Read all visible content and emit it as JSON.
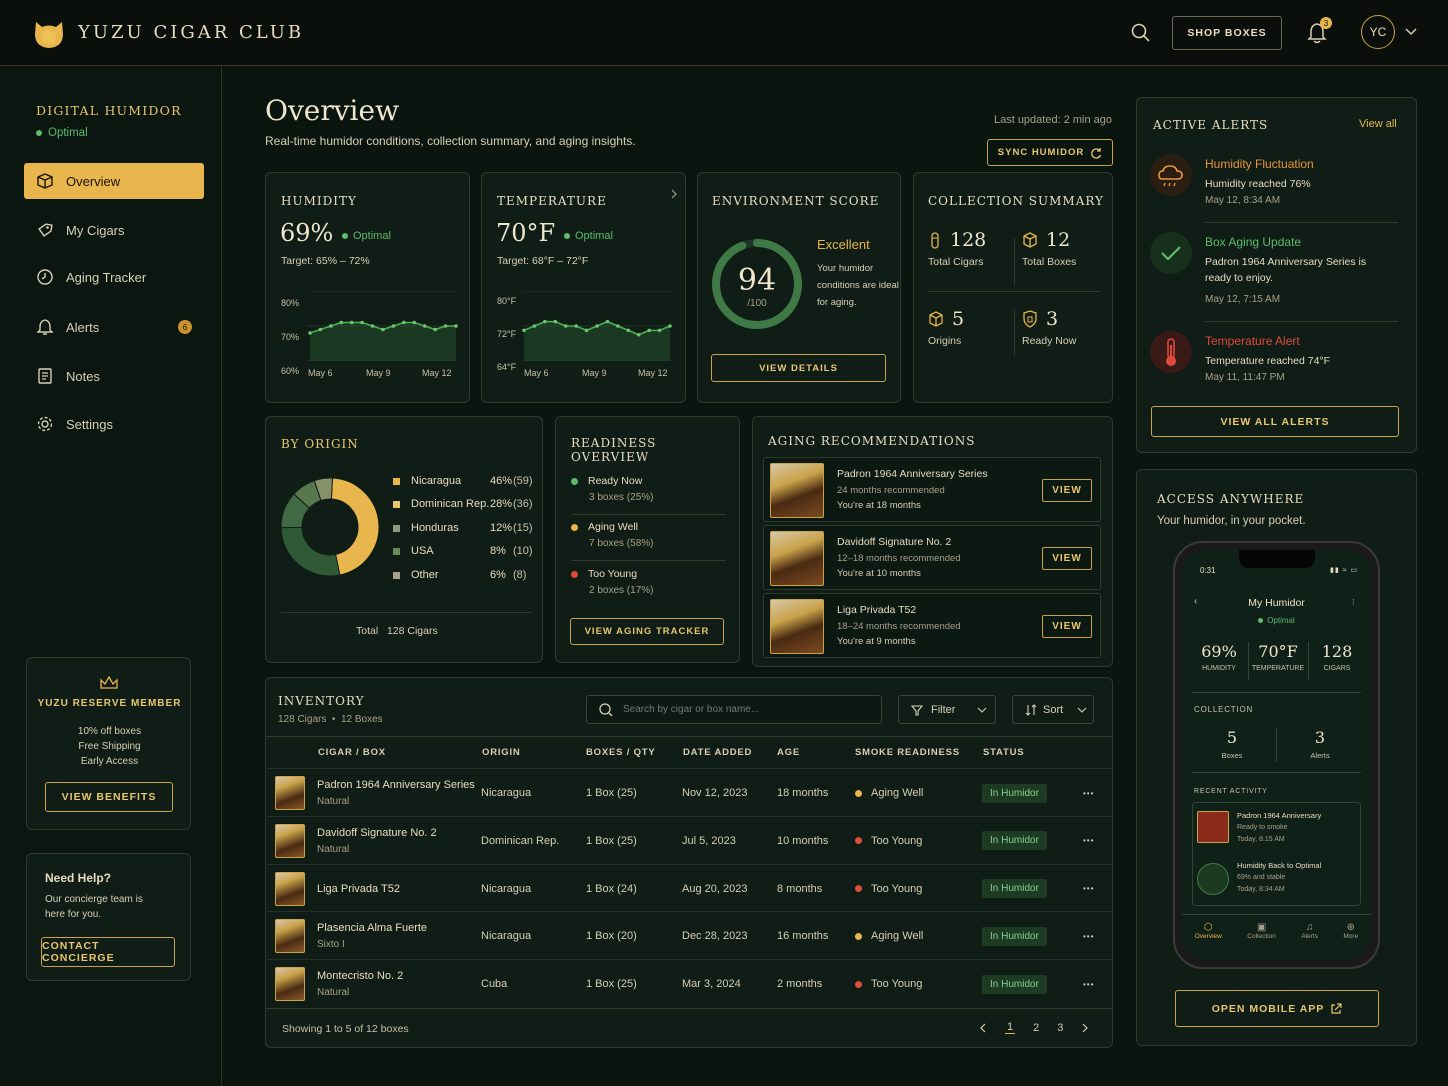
{
  "brand": {
    "name": "YUZU CIGAR CLUB"
  },
  "header": {
    "shop_label": "SHOP BOXES",
    "notif_count": "3",
    "avatar": "YC"
  },
  "sidebar": {
    "section_title": "DIGITAL HUMIDOR",
    "status": "Optimal",
    "items": [
      {
        "label": "Overview",
        "icon": "box-icon"
      },
      {
        "label": "My Cigars",
        "icon": "tag-icon"
      },
      {
        "label": "Aging Tracker",
        "icon": "clock-icon"
      },
      {
        "label": "Alerts",
        "icon": "bell-icon",
        "badge": "6"
      },
      {
        "label": "Notes",
        "icon": "note-icon"
      },
      {
        "label": "Settings",
        "icon": "gear-icon"
      }
    ],
    "member": {
      "title": "YUZU RESERVE MEMBER",
      "perks": [
        "10% off boxes",
        "Free Shipping",
        "Early Access"
      ],
      "button": "VIEW BENEFITS"
    },
    "help": {
      "title": "Need Help?",
      "text": "Our concierge team is here for you.",
      "button": "CONTACT CONCIERGE"
    }
  },
  "page": {
    "title": "Overview",
    "subtitle": "Real-time humidor conditions, collection summary, and aging insights.",
    "updated": "Last updated: 2 min ago",
    "sync": "SYNC HUMIDOR"
  },
  "humidity": {
    "title": "HUMIDITY",
    "value": "69%",
    "status": "Optimal",
    "target": "Target: 65% – 72%",
    "yticks": [
      "80%",
      "70%",
      "60%"
    ],
    "xticks": [
      "May 6",
      "May 9",
      "May 12"
    ]
  },
  "temperature": {
    "title": "TEMPERATURE",
    "value": "70°F",
    "status": "Optimal",
    "target": "Target: 68°F – 72°F",
    "yticks": [
      "80°F",
      "72°F",
      "64°F"
    ],
    "xticks": [
      "May 6",
      "May 9",
      "May 12"
    ]
  },
  "chart_data": [
    {
      "type": "area",
      "title": "HUMIDITY",
      "ylim": [
        60,
        80
      ],
      "values": [
        68,
        69,
        70,
        71,
        71,
        71,
        70,
        69,
        70,
        71,
        71,
        70,
        69,
        70,
        70
      ],
      "color": "#4caf50"
    },
    {
      "type": "area",
      "title": "TEMPERATURE",
      "ylim": [
        64,
        80
      ],
      "values": [
        71,
        72,
        73,
        73,
        72,
        72,
        71,
        72,
        73,
        72,
        71,
        70,
        71,
        71,
        72
      ],
      "color": "#4caf50"
    },
    {
      "type": "pie",
      "title": "BY ORIGIN",
      "categories": [
        "Nicaragua",
        "Dominican Rep.",
        "Honduras",
        "USA",
        "Other"
      ],
      "values": [
        46,
        28,
        12,
        8,
        6
      ],
      "colors": [
        "#e8b64c",
        "#2f5a36",
        "#3f6a44",
        "#56784c",
        "#88906a"
      ]
    }
  ],
  "env": {
    "title": "ENVIRONMENT SCORE",
    "score": "94",
    "max": "/100",
    "score_value": 94,
    "label": "Excellent",
    "desc": "Your humidor conditions are ideal for aging.",
    "button": "VIEW DETAILS"
  },
  "collection": {
    "title": "COLLECTION SUMMARY",
    "stats": [
      {
        "value": "128",
        "label": "Total Cigars"
      },
      {
        "value": "12",
        "label": "Total Boxes"
      },
      {
        "value": "5",
        "label": "Origins"
      },
      {
        "value": "3",
        "label": "Ready Now"
      }
    ]
  },
  "origin": {
    "title": "BY ORIGIN",
    "rows": [
      {
        "name": "Nicaragua",
        "pct": "46%",
        "count": "(59)",
        "color": "#e8b64c"
      },
      {
        "name": "Dominican Rep.",
        "pct": "28%",
        "count": "(36)",
        "color": "#e8c670"
      },
      {
        "name": "Honduras",
        "pct": "12%",
        "count": "(15)",
        "color": "#8a9a78"
      },
      {
        "name": "USA",
        "pct": "8%",
        "count": "(10)",
        "color": "#6a8a5a"
      },
      {
        "name": "Other",
        "pct": "6%",
        "count": "(8)",
        "color": "#a8a088"
      }
    ],
    "total_label": "Total",
    "total": "128 Cigars"
  },
  "readiness": {
    "title": "READINESS OVERVIEW",
    "rows": [
      {
        "label": "Ready Now",
        "sub": "3 boxes (25%)",
        "color": "#5dbb6a"
      },
      {
        "label": "Aging Well",
        "sub": "7 boxes (58%)",
        "color": "#e8b64c"
      },
      {
        "label": "Too Young",
        "sub": "2 boxes (17%)",
        "color": "#e04a3a"
      }
    ],
    "button": "VIEW AGING TRACKER"
  },
  "aging": {
    "title": "AGING RECOMMENDATIONS",
    "items": [
      {
        "name": "Padron 1964 Anniversary Series",
        "rec": "24 months recommended",
        "at": "You're at 18 months",
        "button": "VIEW"
      },
      {
        "name": "Davidoff Signature No. 2",
        "rec": "12–18 months recommended",
        "at": "You're at 10 months",
        "button": "VIEW"
      },
      {
        "name": "Liga Privada T52",
        "rec": "18–24 months recommended",
        "at": "You're at 9 months",
        "button": "VIEW"
      }
    ]
  },
  "inventory": {
    "title": "INVENTORY",
    "sub1": "128 Cigars",
    "sub2": "12 Boxes",
    "search_placeholder": "Search by cigar or box name...",
    "filter": "Filter",
    "sort": "Sort",
    "columns": [
      "CIGAR / BOX",
      "ORIGIN",
      "BOXES / QTY",
      "DATE ADDED",
      "AGE",
      "SMOKE READINESS",
      "STATUS"
    ],
    "rows": [
      {
        "name": "Padron 1964 Anniversary Series",
        "wrapper": "Natural",
        "origin": "Nicaragua",
        "qty": "1 Box  (25)",
        "date": "Nov 12, 2023",
        "age": "18 months",
        "ready": "Aging Well",
        "ready_color": "#e8b64c",
        "status": "In Humidor"
      },
      {
        "name": "Davidoff Signature No. 2",
        "wrapper": "Natural",
        "origin": "Dominican Rep.",
        "qty": "1 Box  (25)",
        "date": "Jul 5, 2023",
        "age": "10 months",
        "ready": "Too Young",
        "ready_color": "#e04a3a",
        "status": "In Humidor"
      },
      {
        "name": "Liga Privada T52",
        "wrapper": "",
        "origin": "Nicaragua",
        "qty": "1 Box  (24)",
        "date": "Aug 20, 2023",
        "age": "8 months",
        "ready": "Too Young",
        "ready_color": "#e04a3a",
        "status": "In Humidor"
      },
      {
        "name": "Plasencia Alma Fuerte",
        "wrapper": "Sixto I",
        "origin": "Nicaragua",
        "qty": "1 Box  (20)",
        "date": "Dec 28, 2023",
        "age": "16 months",
        "ready": "Aging Well",
        "ready_color": "#e8b64c",
        "status": "In Humidor"
      },
      {
        "name": "Montecristo No. 2",
        "wrapper": "Natural",
        "origin": "Cuba",
        "qty": "1 Box  (25)",
        "date": "Mar 3, 2024",
        "age": "2 months",
        "ready": "Too Young",
        "ready_color": "#e04a3a",
        "status": "In Humidor"
      }
    ],
    "footer": "Showing 1 to 5 of 12 boxes",
    "pages": [
      "1",
      "2",
      "3"
    ]
  },
  "alerts": {
    "title": "ACTIVE ALERTS",
    "view_all": "View all",
    "items": [
      {
        "title": "Humidity Fluctuation",
        "text": "Humidity reached 76%",
        "time": "May 12, 8:34 AM",
        "color": "#e8963a",
        "icon": "cloud-icon"
      },
      {
        "title": "Box Aging Update",
        "text": "Padron 1964 Anniversary Series is ready to enjoy.",
        "time": "May 12, 7:15 AM",
        "color": "#5dbb6a",
        "icon": "check-icon"
      },
      {
        "title": "Temperature Alert",
        "text": "Temperature reached 74°F",
        "time": "May 11, 11:47 PM",
        "color": "#e04a3a",
        "icon": "thermometer-icon"
      }
    ],
    "button": "VIEW ALL ALERTS"
  },
  "access": {
    "title": "ACCESS ANYWHERE",
    "sub": "Your humidor, in your pocket.",
    "button": "OPEN MOBILE APP"
  },
  "phone": {
    "time": "0:31",
    "title": "My Humidor",
    "status": "Optimal",
    "stats": [
      {
        "value": "69%",
        "label": "HUMIDITY"
      },
      {
        "value": "70°F",
        "label": "TEMPERATURE"
      },
      {
        "value": "128",
        "label": "CIGARS"
      }
    ],
    "collection_label": "COLLECTION",
    "coll": [
      {
        "value": "5",
        "label": "Boxes"
      },
      {
        "value": "3",
        "label": "Alerts"
      }
    ],
    "recent_label": "RECENT ACTIVITY",
    "activity": [
      {
        "title": "Padron 1964 Anniversary",
        "sub": "Ready to smoke",
        "time": "Today, 8:15 AM"
      },
      {
        "title": "Humidity Back to Optimal",
        "sub": "69% and stable",
        "time": "Today, 8:34 AM"
      }
    ],
    "tabs": [
      "Overview",
      "Collection",
      "Alerts",
      "More"
    ]
  }
}
